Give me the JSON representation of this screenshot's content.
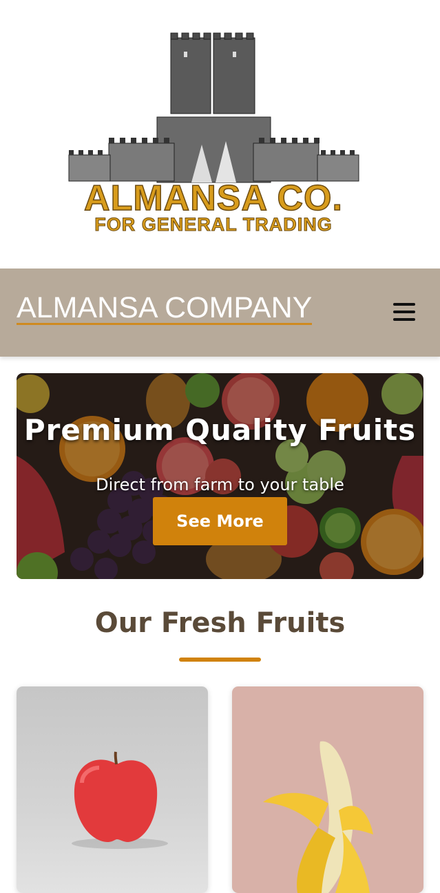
{
  "logo": {
    "line1": "ALMANSA CO.",
    "line2": "FOR GENERAL TRADING"
  },
  "nav": {
    "brand": "ALMANSA COMPANY",
    "menu_icon": "hamburger-menu-icon"
  },
  "hero": {
    "title": "Premium Quality Fruits",
    "subtitle": "Direct from farm to your table",
    "button_label": "See More"
  },
  "products": {
    "title": "Our Fresh Fruits",
    "items": [
      {
        "image": "apple"
      },
      {
        "image": "banana"
      }
    ]
  },
  "colors": {
    "accent": "#d0820c",
    "navbar": "#b7aa9a",
    "heading": "#5a4a38"
  }
}
